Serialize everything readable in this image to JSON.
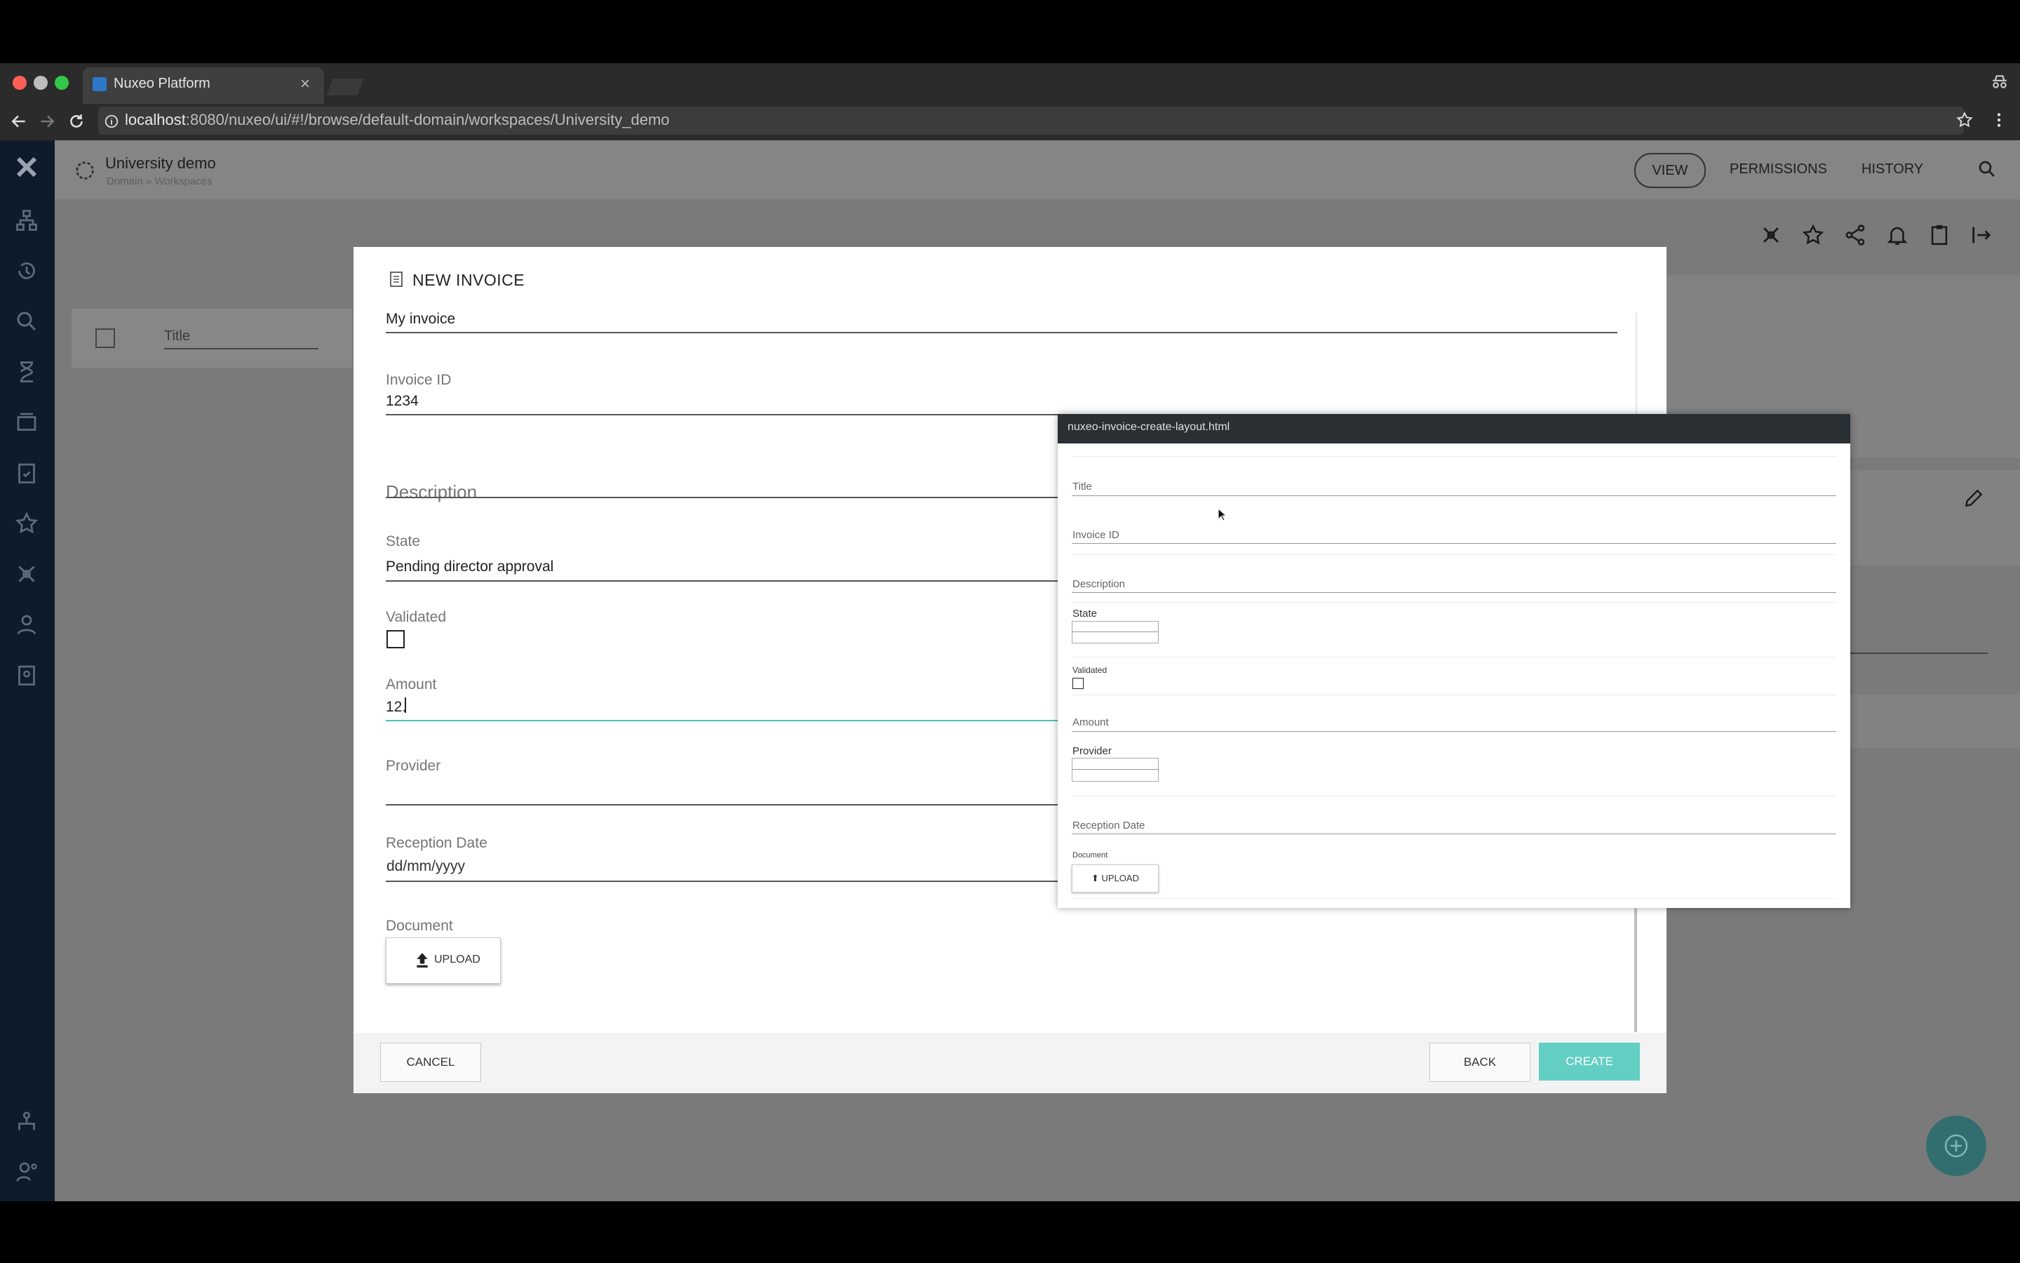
{
  "browser": {
    "tab_title": "Nuxeo Platform",
    "tab_close": "×",
    "url_host": "localhost",
    "url_rest": ":8080/nuxeo/ui/#!/browse/default-domain/workspaces/University_demo"
  },
  "header": {
    "title": "University demo",
    "breadcrumb": "Domain » Workspaces",
    "tabs": [
      "VIEW",
      "PERMISSIONS",
      "HISTORY"
    ]
  },
  "list": {
    "column_title": "Title"
  },
  "dialog": {
    "title": "NEW INVOICE",
    "fields": {
      "title_value": "My invoice",
      "invoice_id_label": "Invoice ID",
      "invoice_id_value": "1234",
      "description_label": "Description",
      "state_label": "State",
      "state_value": "Pending director approval",
      "validated_label": "Validated",
      "amount_label": "Amount",
      "amount_value": "12.",
      "provider_label": "Provider",
      "reception_date_label": "Reception Date",
      "reception_date_placeholder": "dd/mm/yyyy",
      "document_label": "Document",
      "upload_label": "UPLOAD"
    },
    "buttons": {
      "cancel": "CANCEL",
      "back": "BACK",
      "create": "CREATE"
    }
  },
  "preview": {
    "filename": "nuxeo-invoice-create-layout.html",
    "labels": {
      "title": "Title",
      "invoice_id": "Invoice ID",
      "description": "Description",
      "state": "State",
      "validated": "Validated",
      "amount": "Amount",
      "provider": "Provider",
      "reception_date": "Reception Date",
      "document": "Document",
      "upload": "UPLOAD"
    }
  },
  "colors": {
    "accent": "#62cfc2",
    "nav_bg": "#0e1b2c",
    "focus_line": "#4cc3b5"
  }
}
